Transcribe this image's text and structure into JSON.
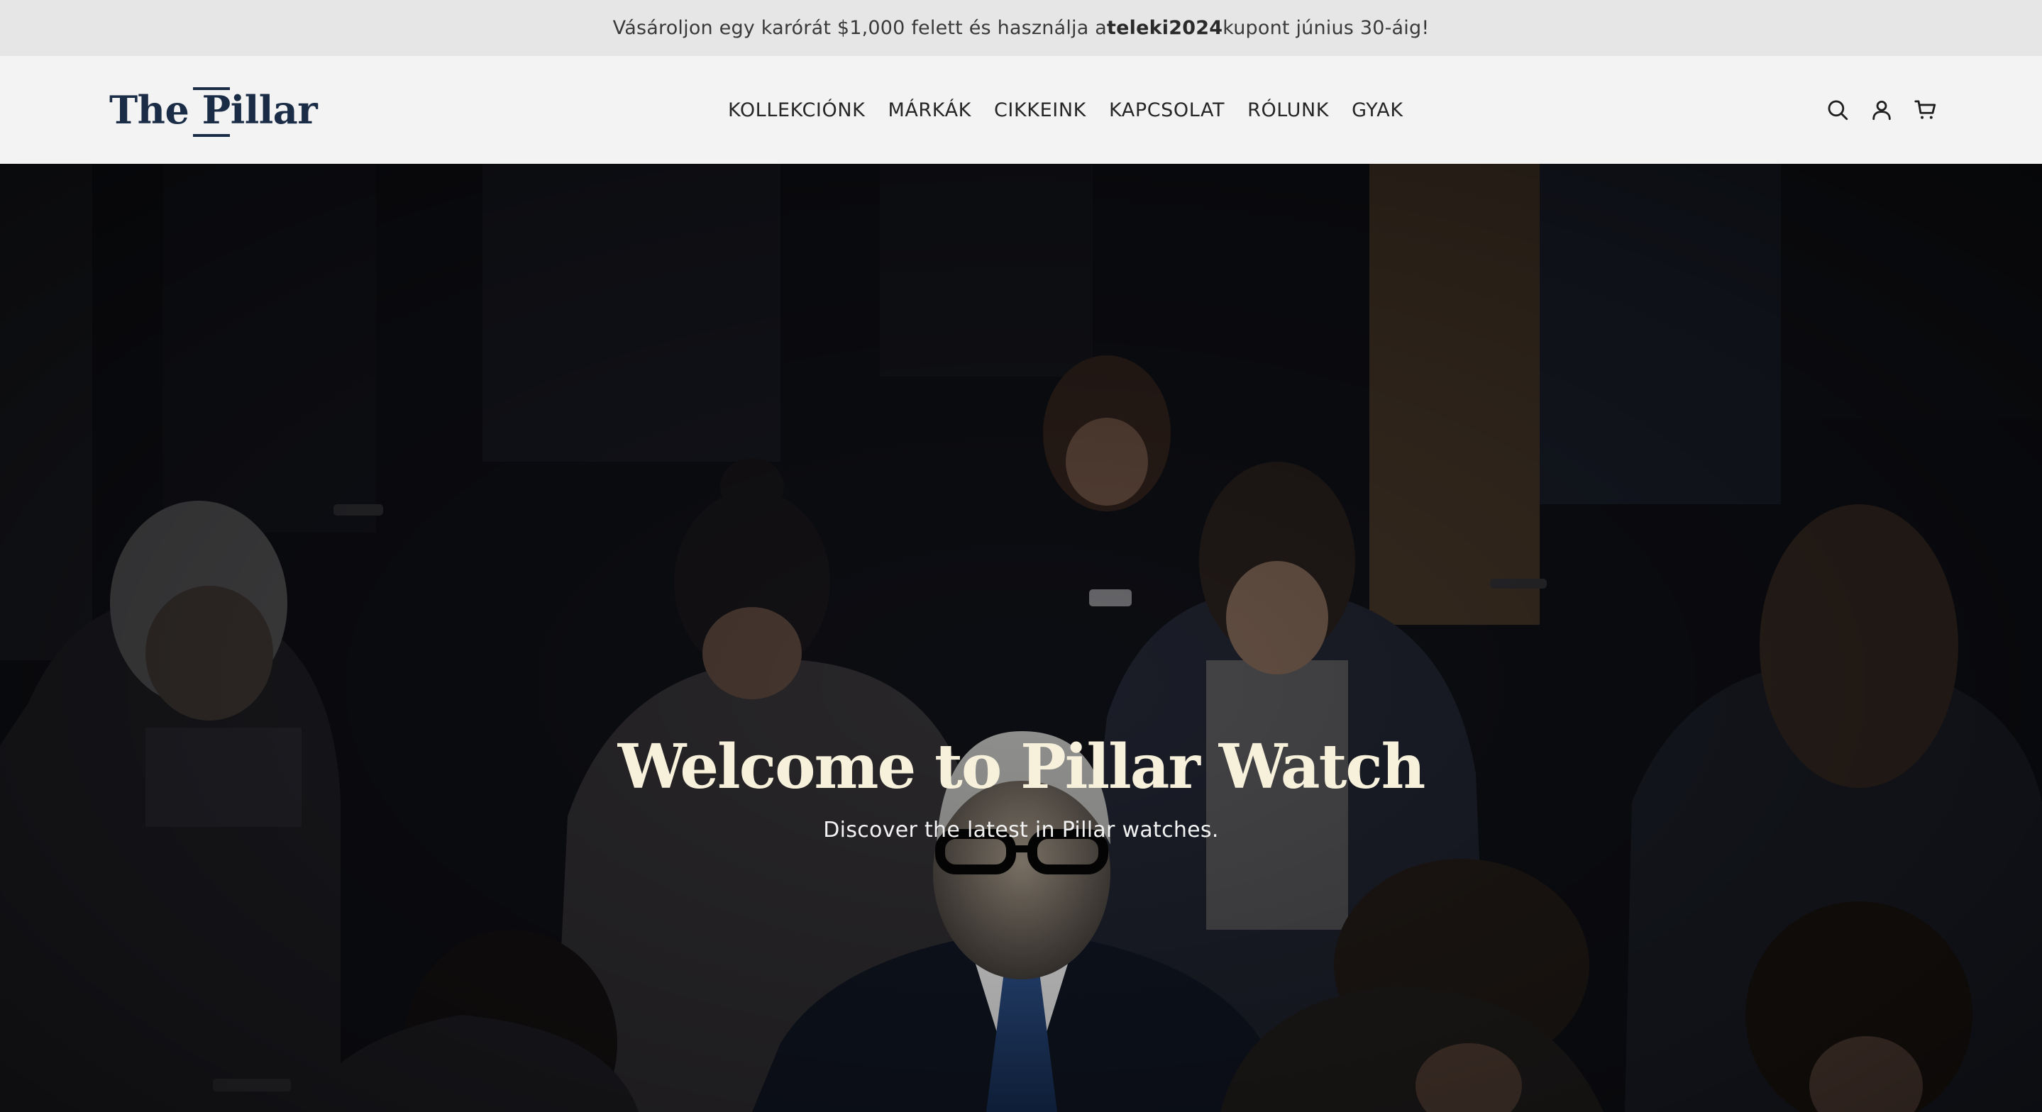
{
  "announcement": {
    "prefix": "Vásároljon egy karórát $1,000 felett és használja a ",
    "code": "teleki2024",
    "suffix": " kupont június 30-áig!"
  },
  "header": {
    "logo_text": "The Pillar",
    "nav": [
      {
        "label": "KOLLEKCIÓNK"
      },
      {
        "label": "MÁRKÁK"
      },
      {
        "label": "CIKKEINK"
      },
      {
        "label": "KAPCSOLAT"
      },
      {
        "label": "RÓLUNK"
      },
      {
        "label": "GYAK"
      }
    ],
    "icons": [
      "search-icon",
      "account-icon",
      "cart-icon"
    ]
  },
  "hero": {
    "title": "Welcome to Pillar Watch",
    "subtitle": "Discover the latest in Pillar watches."
  },
  "colors": {
    "announcement_bg": "#e6e6e6",
    "header_bg": "#f3f3f3",
    "brand": "#1b2c46",
    "hero_title": "#f7f1dc"
  }
}
